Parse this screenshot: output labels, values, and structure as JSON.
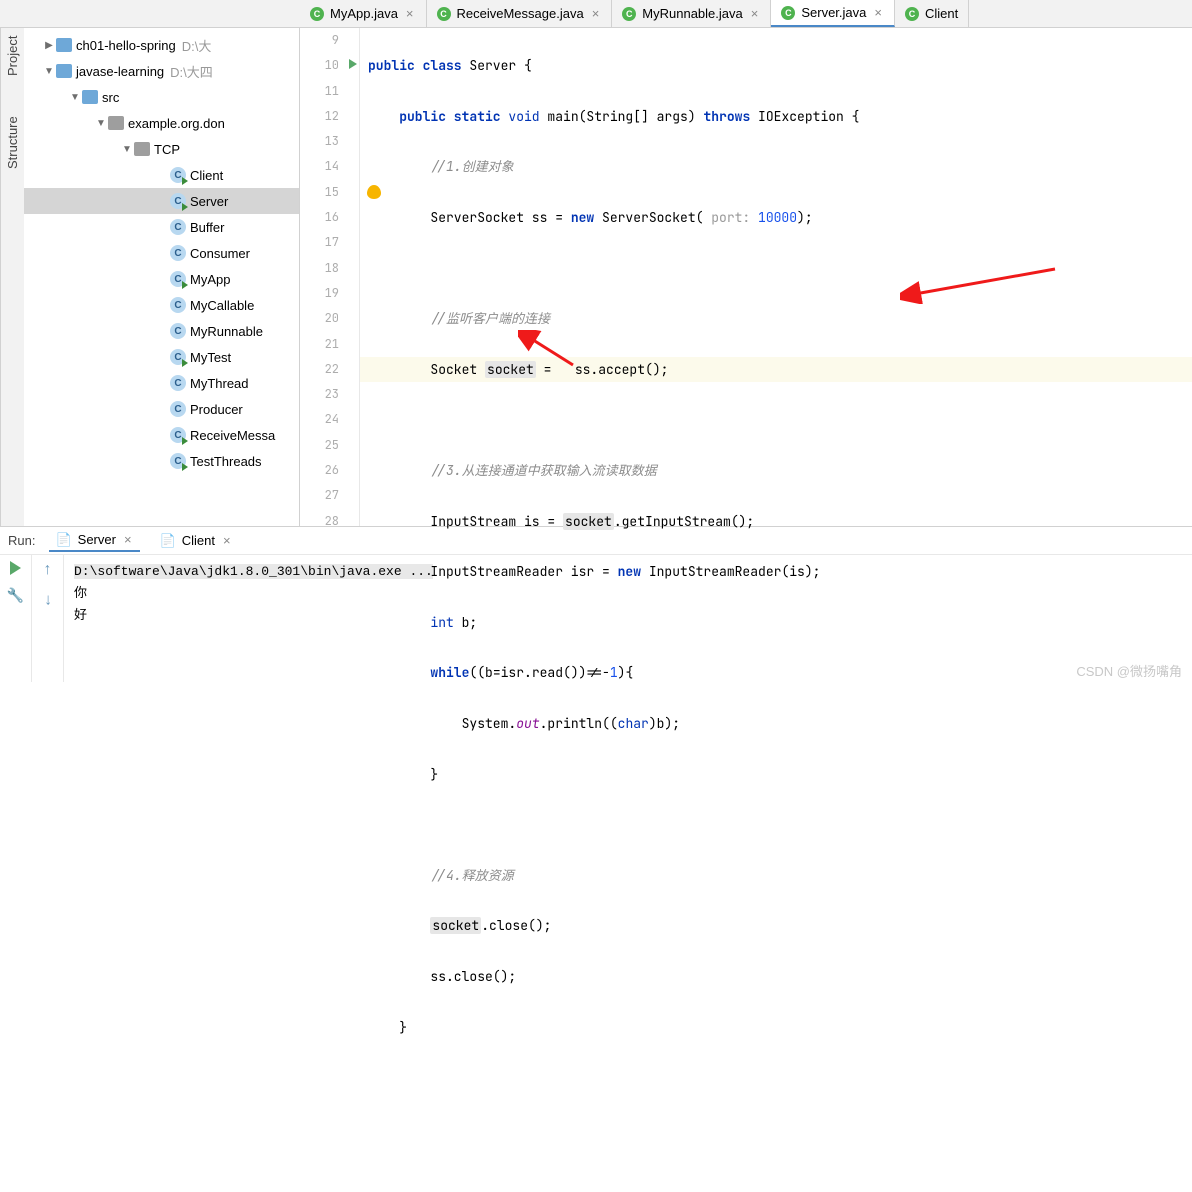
{
  "sideLabel1": "Project",
  "sideLabel2": "Structure",
  "tabs": [
    {
      "label": "MyApp.java"
    },
    {
      "label": "ReceiveMessage.java"
    },
    {
      "label": "MyRunnable.java"
    },
    {
      "label": "Server.java",
      "active": true
    },
    {
      "label": "Client"
    }
  ],
  "tree": {
    "items": [
      {
        "indent": 18,
        "chev": "▶",
        "icon": "folder-blue",
        "label": "ch01-hello-spring",
        "suffix": "D:\\大"
      },
      {
        "indent": 18,
        "chev": "▼",
        "icon": "folder-blue",
        "label": "javase-learning",
        "suffix": "D:\\大四"
      },
      {
        "indent": 44,
        "chev": "▼",
        "icon": "folder-blue",
        "label": "src"
      },
      {
        "indent": 70,
        "chev": "▼",
        "icon": "folder-gray",
        "label": "example.org.don"
      },
      {
        "indent": 96,
        "chev": "▼",
        "icon": "folder-gray",
        "label": "TCP"
      },
      {
        "indent": 132,
        "icon": "class-run",
        "label": "Client"
      },
      {
        "indent": 132,
        "icon": "class-run",
        "label": "Server",
        "selected": true
      },
      {
        "indent": 132,
        "icon": "class",
        "label": "Buffer"
      },
      {
        "indent": 132,
        "icon": "class",
        "label": "Consumer"
      },
      {
        "indent": 132,
        "icon": "class-run",
        "label": "MyApp"
      },
      {
        "indent": 132,
        "icon": "class",
        "label": "MyCallable"
      },
      {
        "indent": 132,
        "icon": "class",
        "label": "MyRunnable"
      },
      {
        "indent": 132,
        "icon": "class-run",
        "label": "MyTest"
      },
      {
        "indent": 132,
        "icon": "class",
        "label": "MyThread"
      },
      {
        "indent": 132,
        "icon": "class",
        "label": "Producer"
      },
      {
        "indent": 132,
        "icon": "class-run",
        "label": "ReceiveMessa"
      },
      {
        "indent": 132,
        "icon": "class-run",
        "label": "TestThreads"
      }
    ]
  },
  "gutter": [
    "9",
    "10",
    "11",
    "12",
    "13",
    "14",
    "15",
    "16",
    "17",
    "18",
    "19",
    "20",
    "21",
    "22",
    "23",
    "24",
    "25",
    "26",
    "27",
    "28"
  ],
  "code": {
    "l9": {
      "kw": "public class ",
      "rest": "Server {"
    },
    "l10a": "public static ",
    "l10b": "void ",
    "l10c": "main(String[] args) ",
    "l10d": "throws ",
    "l10e": "IOException {",
    "l11": "//1.创建对象",
    "l12a": "ServerSocket ss = ",
    "l12b": "new ",
    "l12c": "ServerSocket(",
    "l12hint": " port: ",
    "l12num": "10000",
    "l12d": ");",
    "l14": "//监听客户端的连接",
    "l15a": "Socket ",
    "l15box": "socket",
    "l15b": " =   ss.accept();",
    "l17": "//3.从连接通道中获取输入流读取数据",
    "l18a": "InputStream is = ",
    "l18box": "socket",
    "l18b": ".getInputStream();",
    "l19a": "InputStreamReader isr = ",
    "l19b": "new ",
    "l19c": "InputStreamReader(is);",
    "l20a": "int ",
    "l20b": "b;",
    "l21a": "while",
    "l21b": "((b=isr.read())!=-",
    "l21num": "1",
    "l21c": "){",
    "l22a": "System.",
    "l22b": "out",
    "l22c": ".println((",
    "l22d": "char",
    "l22e": ")b);",
    "l23": "}",
    "l25": "//4.释放资源",
    "l26a": "socket",
    "l26b": ".close();",
    "l27": "ss.close();",
    "l28": "}"
  },
  "run": {
    "label": "Run:",
    "tab1": "Server",
    "tab2": "Client",
    "line1": "D:\\software\\Java\\jdk1.8.0_301\\bin\\java.exe ...",
    "line2": "你",
    "line3": "好"
  },
  "watermark": "CSDN @微扬嘴角"
}
